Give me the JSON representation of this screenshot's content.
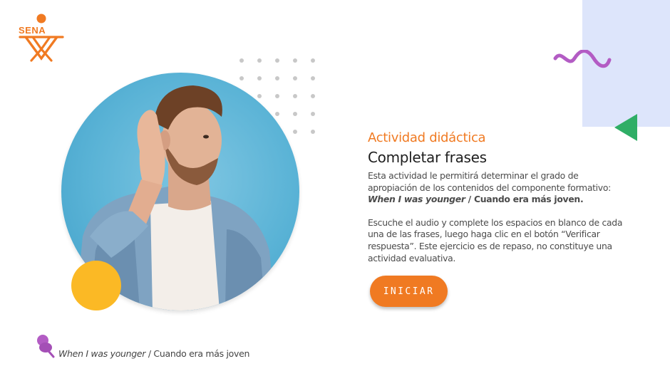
{
  "brand": {
    "logo_text": "SENA",
    "logo_icon": "sena-logo-icon",
    "color": "#f07a22"
  },
  "hero": {
    "image": "man-listening-hand-to-ear-photo"
  },
  "activity": {
    "kicker": "Actividad didáctica",
    "title": "Completar frases",
    "intro_part1": "Esta actividad le permitirá determinar el grado de apropiación de los contenidos del componente formativo: ",
    "intro_english": "When I was younger",
    "intro_separator": " / ",
    "intro_spanish": "Cuando era más joven.",
    "instructions": "Escuche el audio y complete los espacios en blanco de cada una de las frases, luego haga clic en el botón “Verificar respuesta”.  Este ejercicio es de repaso, no constituye una actividad evaluativa."
  },
  "start_button": {
    "label": "INICIAR"
  },
  "footer": {
    "icon": "pushpin-icon",
    "english": "When I was younger",
    "separator": " / ",
    "spanish": "Cuando era más joven"
  },
  "colors": {
    "accent_orange": "#f07a22",
    "yellow": "#fbb925",
    "purple": "#b35cc4",
    "green": "#2fae66",
    "light_blue": "#dde5fb",
    "photo_blue": "#5ab3d6"
  }
}
